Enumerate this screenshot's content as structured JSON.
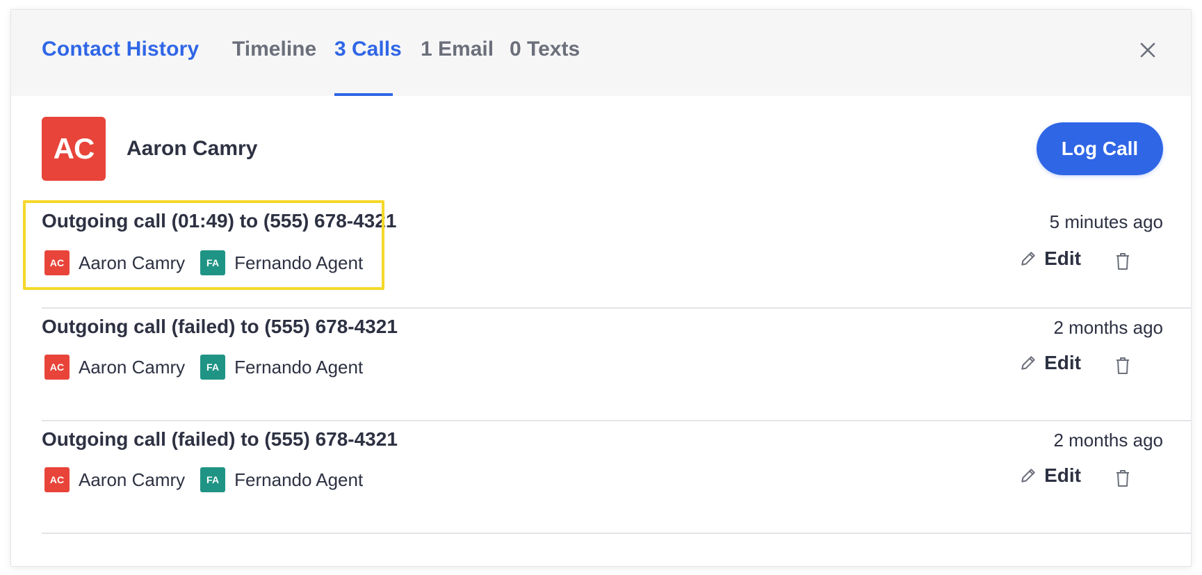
{
  "header": {
    "title": "Contact History",
    "tabs": [
      {
        "label": "Timeline",
        "active": false
      },
      {
        "label": "3 Calls",
        "active": true
      },
      {
        "label": "1 Email",
        "active": false
      },
      {
        "label": "0 Texts",
        "active": false
      }
    ],
    "close_icon": "close-icon"
  },
  "contact": {
    "initials": "AC",
    "name": "Aaron Camry",
    "avatar_color": "#e8443a"
  },
  "actions": {
    "log_call_label": "Log Call"
  },
  "colors": {
    "accent": "#2f66e6",
    "contact_badge": "#e8443a",
    "agent_badge": "#1f9485",
    "highlight": "#f5d82a"
  },
  "calls": [
    {
      "title": "Outgoing call (01:49) to (555) 678-4321",
      "time": "5 minutes ago",
      "participants": [
        {
          "initials": "AC",
          "name": "Aaron Camry"
        },
        {
          "initials": "FA",
          "name": "Fernando Agent"
        }
      ],
      "edit_label": "Edit",
      "highlighted": true
    },
    {
      "title": "Outgoing call (failed) to (555) 678-4321",
      "time": "2 months ago",
      "participants": [
        {
          "initials": "AC",
          "name": "Aaron Camry"
        },
        {
          "initials": "FA",
          "name": "Fernando Agent"
        }
      ],
      "edit_label": "Edit",
      "highlighted": false
    },
    {
      "title": "Outgoing call (failed) to (555) 678-4321",
      "time": "2 months ago",
      "participants": [
        {
          "initials": "AC",
          "name": "Aaron Camry"
        },
        {
          "initials": "FA",
          "name": "Fernando Agent"
        }
      ],
      "edit_label": "Edit",
      "highlighted": false
    }
  ]
}
